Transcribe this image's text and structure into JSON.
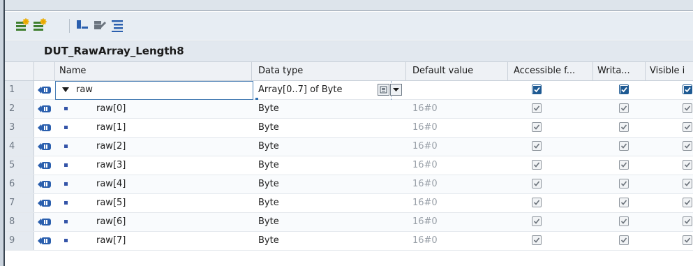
{
  "block": {
    "title": "DUT_RawArray_Length8"
  },
  "toolbar": {
    "buttons": [
      {
        "icon": "insert-row-icon"
      },
      {
        "icon": "add-row-icon"
      },
      {
        "icon": "expand-all-icon"
      },
      {
        "icon": "collapse-all-icon"
      },
      {
        "icon": "list-view-icon"
      }
    ]
  },
  "columns": {
    "name": "Name",
    "data_type": "Data type",
    "default_value": "Default value",
    "accessible": "Accessible f...",
    "writable": "Writa...",
    "visible": "Visible i"
  },
  "rows": [
    {
      "num": "1",
      "name": "raw",
      "type": "Array[0..7] of Byte",
      "default": "",
      "accessible": true,
      "writable": true,
      "visible": true,
      "expandable": true,
      "selected": true
    },
    {
      "num": "2",
      "name": "raw[0]",
      "type": "Byte",
      "default": "16#0",
      "accessible": true,
      "writable": true,
      "visible": true
    },
    {
      "num": "3",
      "name": "raw[1]",
      "type": "Byte",
      "default": "16#0",
      "accessible": true,
      "writable": true,
      "visible": true
    },
    {
      "num": "4",
      "name": "raw[2]",
      "type": "Byte",
      "default": "16#0",
      "accessible": true,
      "writable": true,
      "visible": true
    },
    {
      "num": "5",
      "name": "raw[3]",
      "type": "Byte",
      "default": "16#0",
      "accessible": true,
      "writable": true,
      "visible": true
    },
    {
      "num": "6",
      "name": "raw[4]",
      "type": "Byte",
      "default": "16#0",
      "accessible": true,
      "writable": true,
      "visible": true
    },
    {
      "num": "7",
      "name": "raw[5]",
      "type": "Byte",
      "default": "16#0",
      "accessible": true,
      "writable": true,
      "visible": true
    },
    {
      "num": "8",
      "name": "raw[6]",
      "type": "Byte",
      "default": "16#0",
      "accessible": true,
      "writable": true,
      "visible": true
    },
    {
      "num": "9",
      "name": "raw[7]",
      "type": "Byte",
      "default": "16#0",
      "accessible": true,
      "writable": true,
      "visible": true
    }
  ],
  "colors": {
    "accent": "#1e5a93",
    "selection_border": "#4a7fb5",
    "header_bg": "#eef1f5",
    "row_number_bg": "#e5eaf0"
  }
}
